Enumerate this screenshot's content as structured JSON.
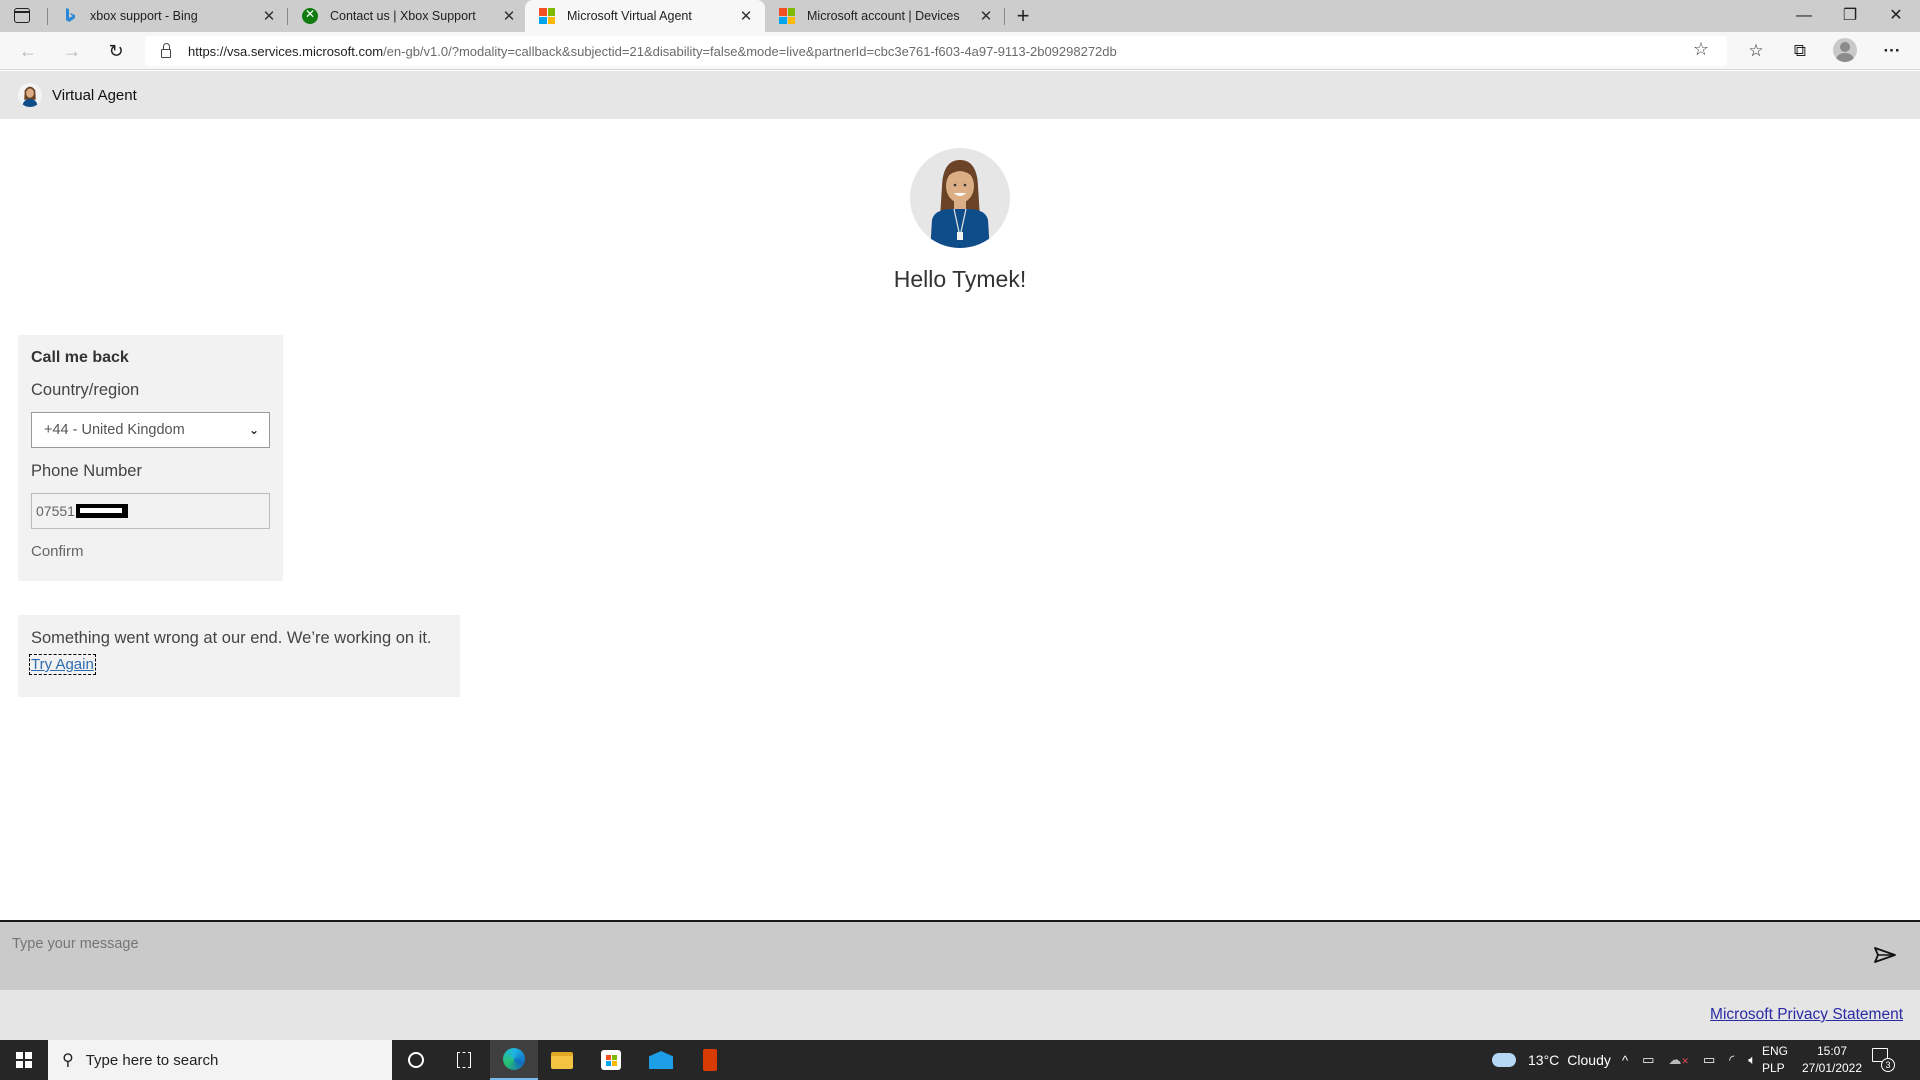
{
  "browser": {
    "tabs": [
      {
        "title": "xbox support - Bing",
        "icon": "bing-icon",
        "active": false
      },
      {
        "title": "Contact us | Xbox Support",
        "icon": "xbox-icon",
        "active": false
      },
      {
        "title": "Microsoft Virtual Agent",
        "icon": "microsoft-icon",
        "active": true
      },
      {
        "title": "Microsoft account | Devices",
        "icon": "microsoft-icon",
        "active": false
      }
    ],
    "new_tab_label": "+",
    "window_controls": {
      "minimize": "—",
      "restore": "❐",
      "close": "✕"
    },
    "address_bar": {
      "url_host": "https://vsa.services.microsoft.com",
      "url_rest": "/en-gb/v1.0/?modality=callback&subjectid=21&disability=false&mode=live&partnerId=cbc3e761-f603-4a97-9113-2b09298272db"
    },
    "nav": {
      "back": "←",
      "forward": "→",
      "refresh": "↻"
    },
    "more_label": "···"
  },
  "page": {
    "header_title": "Virtual Agent",
    "greeting": "Hello Tymek!",
    "callback": {
      "title": "Call me back",
      "country_label": "Country/region",
      "country_value": "+44 - United Kingdom",
      "phone_label": "Phone Number",
      "phone_value": "07551",
      "phone_redacted": true,
      "confirm_label": "Confirm"
    },
    "error": {
      "message": "Something went wrong at our end. We’re working on it.",
      "retry_label": "Try Again"
    },
    "message_placeholder": "Type your message",
    "privacy_link": "Microsoft Privacy Statement"
  },
  "taskbar": {
    "search_placeholder": "Type here to search",
    "weather": {
      "temp": "13°C",
      "condition": "Cloudy"
    },
    "language": {
      "line1": "ENG",
      "line2": "PLP"
    },
    "time": "15:07",
    "date": "27/01/2022",
    "notification_count": "3",
    "pinned": [
      "cortana-icon",
      "task-view-icon",
      "edge-icon",
      "file-explorer-icon",
      "store-icon",
      "mail-icon",
      "office-icon"
    ]
  },
  "colors": {
    "link": "#2b6cb0",
    "privacy_link": "#2a2aa6",
    "agent_shirt": "#0f4c8a",
    "card_bg": "#f2f2f2"
  }
}
